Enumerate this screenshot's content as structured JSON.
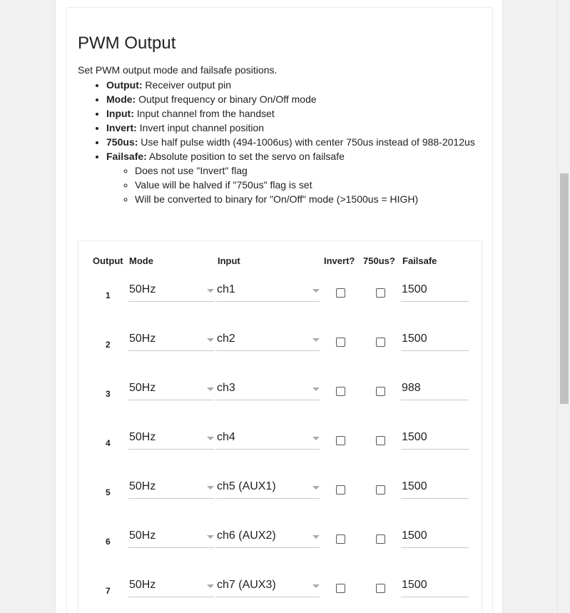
{
  "section": {
    "title": "PWM Output",
    "description": "Set PWM output mode and failsafe positions.",
    "help": [
      {
        "term": "Output:",
        "text": " Receiver output pin"
      },
      {
        "term": "Mode:",
        "text": " Output frequency or binary On/Off mode"
      },
      {
        "term": "Input:",
        "text": " Input channel from the handset"
      },
      {
        "term": "Invert:",
        "text": " Invert input channel position"
      },
      {
        "term": "750us:",
        "text": " Use half pulse width (494-1006us) with center 750us instead of 988-2012us"
      },
      {
        "term": "Failsafe:",
        "text": " Absolute position to set the servo on failsafe"
      }
    ],
    "failsafe_notes": [
      "Does not use \"Invert\" flag",
      "Value will be halved if \"750us\" flag is set",
      "Will be converted to binary for \"On/Off\" mode (>1500us = HIGH)"
    ]
  },
  "table": {
    "headers": {
      "output": "Output",
      "mode": "Mode",
      "input": "Input",
      "invert": "Invert?",
      "us750": "750us?",
      "failsafe": "Failsafe"
    },
    "rows": [
      {
        "output": "1",
        "mode": "50Hz",
        "input": "ch1",
        "invert": false,
        "us750": false,
        "failsafe": "1500"
      },
      {
        "output": "2",
        "mode": "50Hz",
        "input": "ch2",
        "invert": false,
        "us750": false,
        "failsafe": "1500"
      },
      {
        "output": "3",
        "mode": "50Hz",
        "input": "ch3",
        "invert": false,
        "us750": false,
        "failsafe": "988"
      },
      {
        "output": "4",
        "mode": "50Hz",
        "input": "ch4",
        "invert": false,
        "us750": false,
        "failsafe": "1500"
      },
      {
        "output": "5",
        "mode": "50Hz",
        "input": "ch5 (AUX1)",
        "invert": false,
        "us750": false,
        "failsafe": "1500"
      },
      {
        "output": "6",
        "mode": "50Hz",
        "input": "ch6 (AUX2)",
        "invert": false,
        "us750": false,
        "failsafe": "1500"
      },
      {
        "output": "7",
        "mode": "50Hz",
        "input": "ch7 (AUX3)",
        "invert": false,
        "us750": false,
        "failsafe": "1500"
      }
    ]
  }
}
